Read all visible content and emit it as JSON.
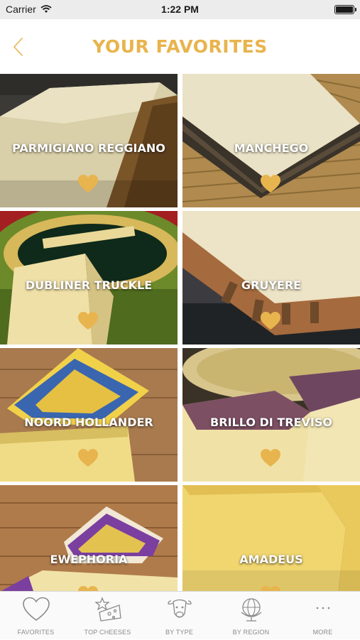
{
  "status_bar": {
    "carrier": "Carrier",
    "time": "1:22 PM"
  },
  "nav": {
    "title": "YOUR FAVORITES"
  },
  "colors": {
    "accent": "#e8b44d",
    "heart": "#e8b44d",
    "tab_label": "#8a8a8a"
  },
  "favorites": [
    {
      "name": "PARMIGIANO REGGIANO",
      "favorited": true
    },
    {
      "name": "MANCHEGO",
      "favorited": true
    },
    {
      "name": "DUBLINER TRUCKLE",
      "favorited": true
    },
    {
      "name": "GRUYERE",
      "favorited": true
    },
    {
      "name": "NOORD HOLLANDER",
      "favorited": true
    },
    {
      "name": "BRILLO DI TREVISO",
      "favorited": true
    },
    {
      "name": "EWEPHORIA",
      "favorited": true
    },
    {
      "name": "AMADEUS",
      "favorited": true
    }
  ],
  "tabs": [
    {
      "label": "FAVORITES",
      "icon": "heart-outline-icon"
    },
    {
      "label": "TOP CHEESES",
      "icon": "cheese-star-icon"
    },
    {
      "label": "BY TYPE",
      "icon": "cow-icon"
    },
    {
      "label": "BY REGION",
      "icon": "globe-icon"
    },
    {
      "label": "MORE",
      "icon": "more-dots-icon"
    }
  ]
}
